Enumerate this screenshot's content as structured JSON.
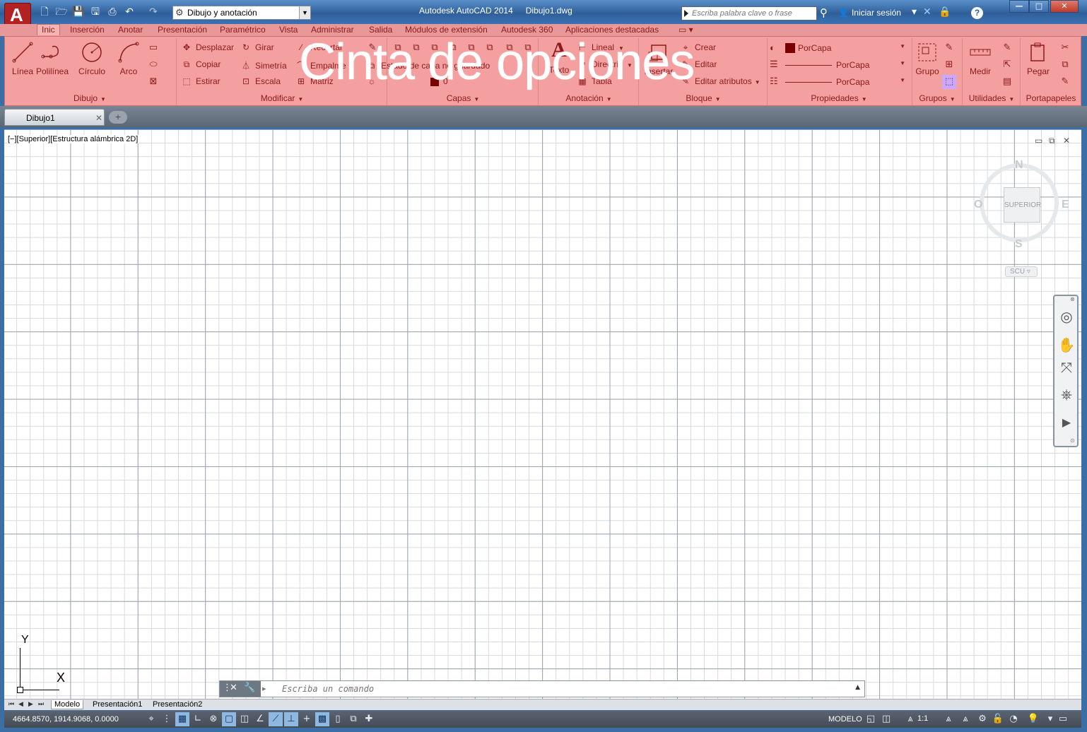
{
  "title_bar": {
    "app_title": "Autodesk AutoCAD 2014",
    "doc_title": "Dibujo1.dwg",
    "logo_letter": "A",
    "workspace": "Dibujo y anotación",
    "search_placeholder": "Escriba palabra clave o frase",
    "signin": "Iniciar sesión",
    "help": "?",
    "minimize": "—",
    "maximize": "□",
    "close": "✕"
  },
  "ribbon_tabs": [
    "Inic",
    "Inserción",
    "Anotar",
    "Presentación",
    "Paramétrico",
    "Vista",
    "Administrar",
    "Salida",
    "Módulos de extensión",
    "Autodesk 360",
    "Aplicaciones destacadas"
  ],
  "ribbon": {
    "overlay_text": "Cinta de opciones",
    "dibujo": {
      "panel": "Dibujo",
      "linea": "Línea",
      "polilinea": "Polilínea",
      "circulo": "Círculo",
      "arco": "Arco"
    },
    "modificar": {
      "panel": "Modificar",
      "desplazar": "Desplazar",
      "girar": "Girar",
      "recortar": "Recortar",
      "copiar": "Copiar",
      "simetria": "Simetría",
      "empalme": "Empalme",
      "estirar": "Estirar",
      "escala": "Escala",
      "matriz": "Matriz"
    },
    "capas": {
      "panel": "Capas",
      "estado": "Estado de capa no guardado",
      "layer": "0"
    },
    "anotacion": {
      "panel": "Anotación",
      "texto": "Texto",
      "lineal": "Lineal",
      "directriz": "Directriz",
      "tabla": "Tabla"
    },
    "bloque": {
      "panel": "Bloque",
      "insertar": "Insertar",
      "crear": "Crear",
      "editar": "Editar",
      "editar_atributos": "Editar atributos"
    },
    "propiedades": {
      "panel": "Propiedades",
      "color": "PorCapa",
      "linetype": "PorCapa",
      "lineweight": "PorCapa"
    },
    "grupos": {
      "panel": "Grupos",
      "grupo": "Grupo"
    },
    "utilidades": {
      "panel": "Utilidades",
      "medir": "Medir"
    },
    "portapapeles": {
      "panel": "Portapapeles",
      "pegar": "Pegar"
    }
  },
  "doc_tab": {
    "name": "Dibujo1",
    "close": "✕",
    "new": "+"
  },
  "viewport": {
    "label": "[−][Superior][Estructura alámbrica 2D]"
  },
  "viewcube": {
    "n": "N",
    "s": "S",
    "e": "E",
    "w": "O",
    "face": "SUPERIOR",
    "ucs": "SCU"
  },
  "ucs_icon": {
    "x": "X",
    "y": "Y"
  },
  "command_line": {
    "placeholder": "Escriba un comando",
    "prompt": "▸"
  },
  "layout_tabs": {
    "modelo": "Modelo",
    "presentacion1": "Presentación1",
    "presentacion2": "Presentación2"
  },
  "status_bar": {
    "coords": "4664.8570, 1914.9068, 0.0000",
    "model": "MODELO",
    "scale": "1:1"
  },
  "colors": {
    "ribbon_bg": "#f4a0a0",
    "ribbon_text": "#8b1a1a",
    "title_bg": "#3c72b3",
    "layer_color": "#7a0000"
  },
  "icons": {
    "qat": [
      "new-icon",
      "open-icon",
      "save-icon",
      "save-as-icon",
      "plot-icon",
      "undo-icon",
      "redo-icon"
    ],
    "dibujo": [
      "line-icon",
      "polyline-icon",
      "circle-icon",
      "arc-icon"
    ],
    "navbar": [
      "steering-wheel-icon",
      "pan-icon",
      "zoom-extents-icon",
      "orbit-icon",
      "showmotion-icon"
    ]
  }
}
